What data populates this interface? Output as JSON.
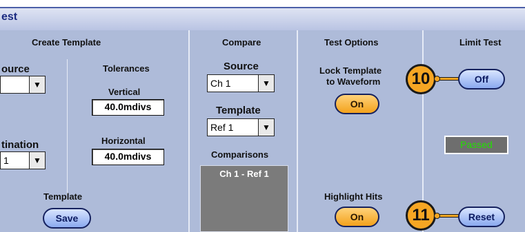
{
  "window": {
    "title_fragment": "est"
  },
  "create_template": {
    "header": "Create Template",
    "source_label_fragment": "ource",
    "source_value_fragment": "",
    "destination_label_fragment": "tination",
    "destination_value_fragment": "1",
    "tolerances_label": "Tolerances",
    "vertical_label": "Vertical",
    "vertical_value": "40.0mdivs",
    "horizontal_label": "Horizontal",
    "horizontal_value": "40.0mdivs",
    "template_label": "Template",
    "save_button": "Save"
  },
  "compare": {
    "header": "Compare",
    "source_label": "Source",
    "source_value": "Ch 1",
    "template_label": "Template",
    "template_value": "Ref 1",
    "comparisons_label": "Comparisons",
    "comparisons_items": [
      "Ch 1 - Ref 1"
    ]
  },
  "test_options": {
    "header": "Test Options",
    "lock_template_label_line1": "Lock Template",
    "lock_template_label_line2": "to Waveform",
    "lock_template_button": "On",
    "highlight_hits_label": "Highlight Hits",
    "highlight_hits_button": "On"
  },
  "limit_test": {
    "header": "Limit Test",
    "toggle_button": "Off",
    "status": "Passed",
    "reset_button": "Reset"
  },
  "callouts": {
    "first": "10",
    "second": "11"
  },
  "icons": {
    "dropdown": "dropdown-arrow-icon"
  },
  "colors": {
    "panel": "#aebbd9",
    "title_text": "#1a2a80",
    "callout": "#f6a623",
    "passed_text": "#22e000"
  }
}
